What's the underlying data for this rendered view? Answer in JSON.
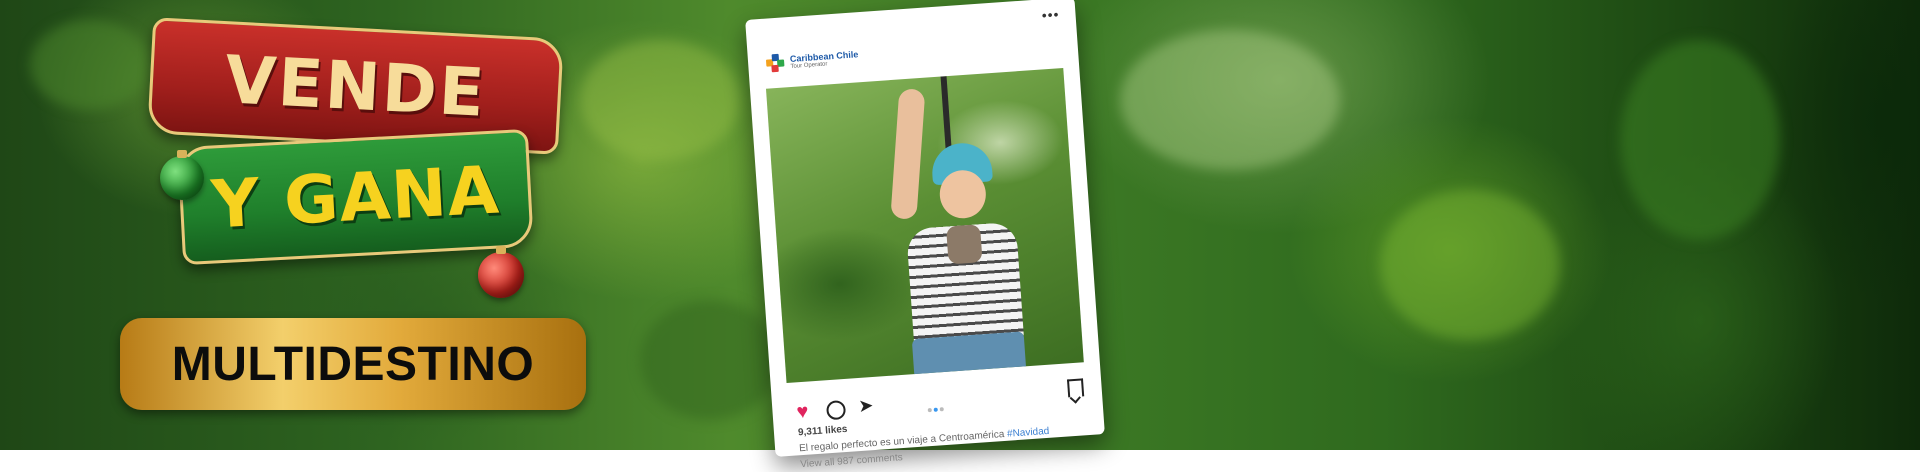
{
  "banner": {
    "title_line1": "VENDE",
    "title_line2": "Y GANA",
    "badge": "MULTIDESTINO"
  },
  "post": {
    "brand": "Caribbean Chile",
    "brand_sub": "Tour Operator",
    "menu": "•••",
    "likes": "9,311 likes",
    "caption": "El regalo perfecto es un viaje a Centroamérica",
    "hashtag": "#Navidad",
    "comments": "View all 987 comments"
  },
  "colors": {
    "red_ribbon": "#b02420",
    "green_ribbon": "#228a30",
    "gold": "#e8c97a",
    "title_yellow": "#f6d21f",
    "heart": "#e0245e",
    "hashtag": "#3b7fd1"
  },
  "icons": [
    "heart-icon",
    "comment-icon",
    "send-icon",
    "bookmark-icon",
    "more-icon"
  ]
}
